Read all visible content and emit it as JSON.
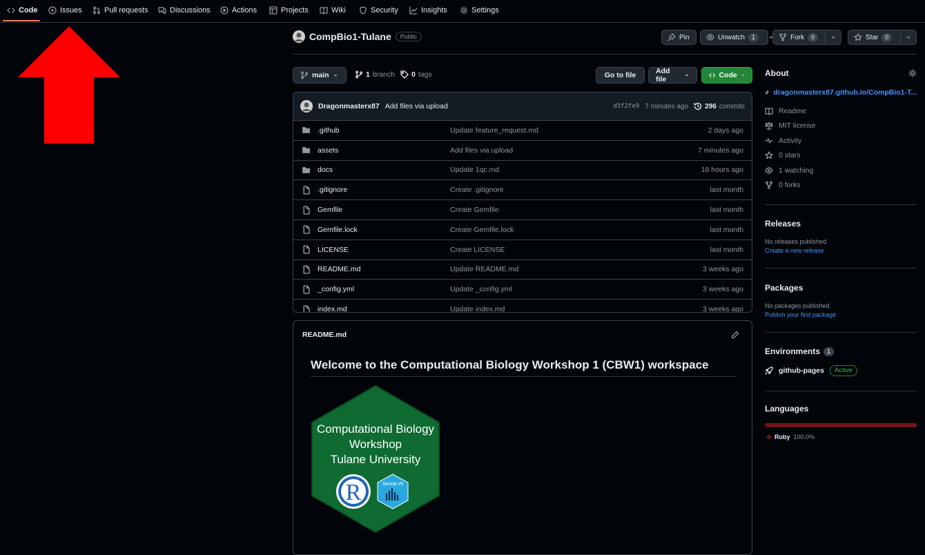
{
  "nav": {
    "tabs": [
      {
        "label": "Code",
        "icon": "code-icon"
      },
      {
        "label": "Issues",
        "icon": "issue-icon"
      },
      {
        "label": "Pull requests",
        "icon": "pull-request-icon"
      },
      {
        "label": "Discussions",
        "icon": "discussions-icon"
      },
      {
        "label": "Actions",
        "icon": "play-icon"
      },
      {
        "label": "Projects",
        "icon": "table-icon"
      },
      {
        "label": "Wiki",
        "icon": "book-icon"
      },
      {
        "label": "Security",
        "icon": "shield-icon"
      },
      {
        "label": "Insights",
        "icon": "graph-icon"
      },
      {
        "label": "Settings",
        "icon": "gear-icon"
      }
    ],
    "selected": "Code"
  },
  "annotation": {
    "arrow_color": "#ff0000"
  },
  "repo": {
    "name": "CompBio1-Tulane",
    "visibility": "Public",
    "pin_label": "Pin",
    "unwatch_label": "Unwatch",
    "watch_count": "1",
    "fork_label": "Fork",
    "fork_count": "0",
    "star_label": "Star",
    "star_count": "0"
  },
  "branch_bar": {
    "branch": "main",
    "branch_count": "1",
    "branch_word": "branch",
    "tag_count": "0",
    "tag_word": "tags",
    "go_to_file": "Go to file",
    "add_file": "Add file",
    "code_button": "Code"
  },
  "latest_commit": {
    "author": "Dragonmasterx87",
    "message": "Add files via upload",
    "sha": "d5f2fe9",
    "time": "7 minutes ago",
    "commit_count": "296",
    "commit_word": "commits"
  },
  "files": [
    {
      "name": ".github",
      "type": "folder",
      "message": "Update feature_request.md",
      "date": "2 days ago"
    },
    {
      "name": "assets",
      "type": "folder",
      "message": "Add files via upload",
      "date": "7 minutes ago"
    },
    {
      "name": "docs",
      "type": "folder",
      "message": "Update 1qc.md",
      "date": "18 hours ago"
    },
    {
      "name": ".gitignore",
      "type": "file",
      "message": "Create .gitignore",
      "date": "last month"
    },
    {
      "name": "Gemfile",
      "type": "file",
      "message": "Create Gemfile",
      "date": "last month"
    },
    {
      "name": "Gemfile.lock",
      "type": "file",
      "message": "Create Gemfile.lock",
      "date": "last month"
    },
    {
      "name": "LICENSE",
      "type": "file",
      "message": "Create LICENSE",
      "date": "last month"
    },
    {
      "name": "README.md",
      "type": "file",
      "message": "Update README.md",
      "date": "3 weeks ago"
    },
    {
      "name": "_config.yml",
      "type": "file",
      "message": "Update _config.yml",
      "date": "3 weeks ago"
    },
    {
      "name": "index.md",
      "type": "file",
      "message": "Update index.md",
      "date": "3 weeks ago"
    }
  ],
  "readme": {
    "filename": "README.md",
    "heading": "Welcome to the Computational Biology Workshop 1 (CBW1) workspace",
    "logo": {
      "line1": "Computational Biology",
      "line2": "Workshop",
      "line3": "Tulane University",
      "r_letter": "R",
      "seurat": "Seurat v5",
      "hex_color": "#0f6b32"
    }
  },
  "about": {
    "title": "About",
    "link": "dragonmasterx87.github.io/CompBio1-T...",
    "items": [
      {
        "label": "Readme",
        "icon": "book-icon"
      },
      {
        "label": "MIT license",
        "icon": "law-icon"
      },
      {
        "label": "Activity",
        "icon": "pulse-icon"
      },
      {
        "label": "0 stars",
        "icon": "star-icon"
      },
      {
        "label": "1 watching",
        "icon": "eye-icon"
      },
      {
        "label": "0 forks",
        "icon": "fork-icon"
      }
    ]
  },
  "releases": {
    "title": "Releases",
    "none": "No releases published",
    "create": "Create a new release"
  },
  "packages": {
    "title": "Packages",
    "none": "No packages published",
    "publish": "Publish your first package"
  },
  "environments": {
    "title": "Environments",
    "count": "1",
    "name": "github-pages",
    "status": "Active"
  },
  "languages": {
    "title": "Languages",
    "name": "Ruby",
    "percent": "100.0%",
    "color": "#701516"
  }
}
